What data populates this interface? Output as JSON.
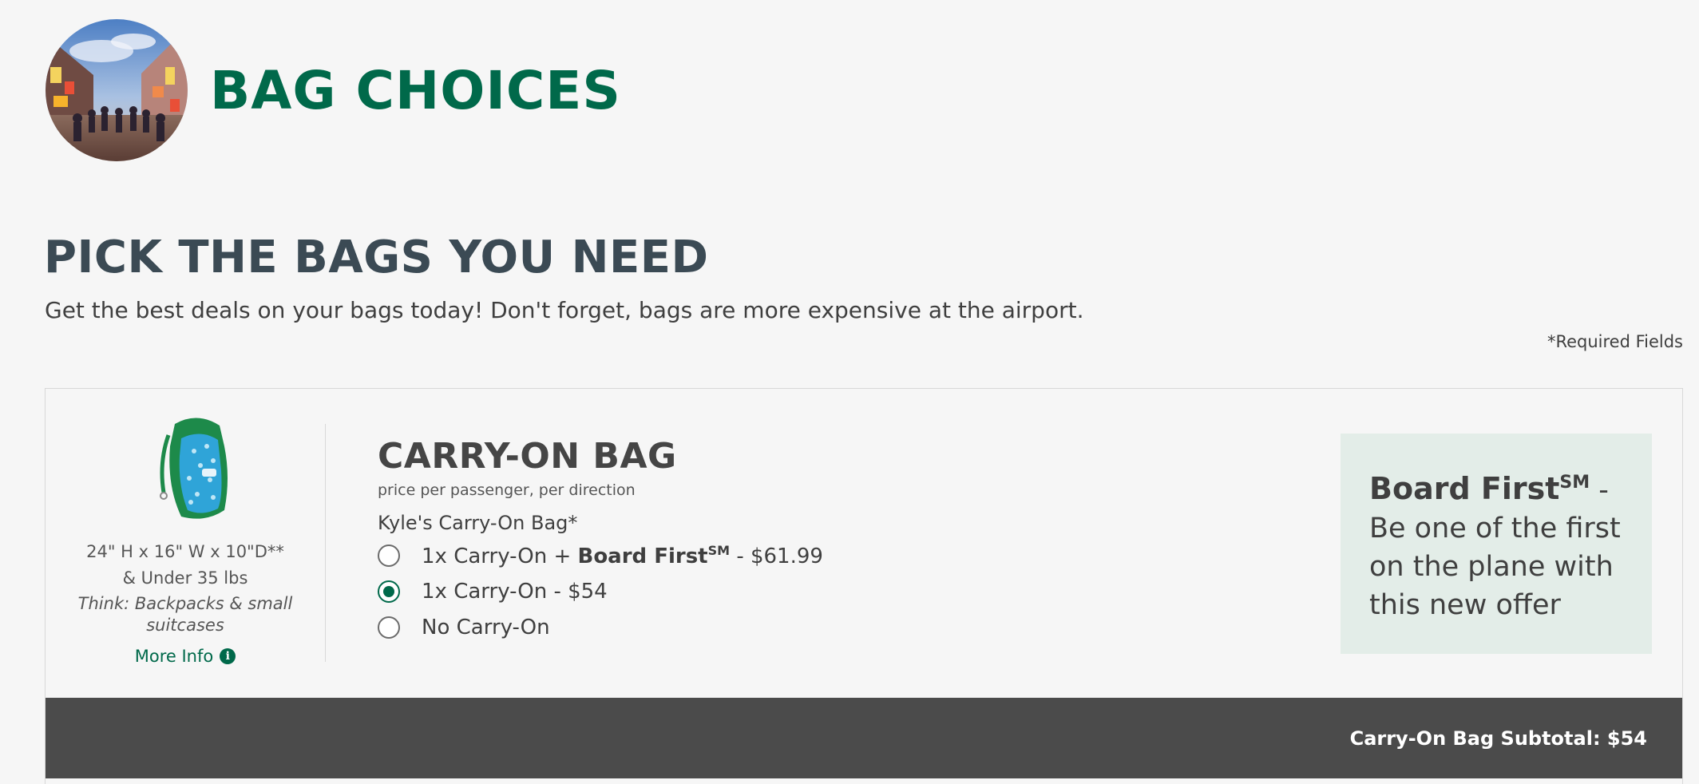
{
  "header": {
    "title": "BAG CHOICES"
  },
  "section": {
    "heading": "PICK THE BAGS YOU NEED",
    "subheading": "Get the best deals on your bags today! Don't forget, bags are more expensive at the airport.",
    "required_note": "*Required Fields"
  },
  "carry_on": {
    "dimensions": "24\" H x 16\" W x 10\"D** & Under 35 lbs",
    "think": "Think: Backpacks & small suitcases",
    "more_info": "More Info",
    "title": "CARRY-ON BAG",
    "price_note": "price per passenger, per direction",
    "passenger_label": "Kyle's Carry-On Bag*",
    "options": [
      {
        "prefix": "1x Carry-On + ",
        "bold": "Board First",
        "sup": "SM",
        "suffix": " - $61.99",
        "selected": false
      },
      {
        "prefix": "1x Carry-On - $54",
        "bold": "",
        "sup": "",
        "suffix": "",
        "selected": true
      },
      {
        "prefix": "No Carry-On",
        "bold": "",
        "sup": "",
        "suffix": "",
        "selected": false
      }
    ],
    "promo": {
      "bold": "Board First",
      "sup": "SM",
      "text": " - Be one of the first on the plane with this new offer"
    },
    "subtotal": "Carry-On Bag Subtotal: $54"
  },
  "colors": {
    "brand_green": "#00694a",
    "heading_slate": "#3b4a54",
    "promo_bg": "#e3ede8",
    "subtotal_bg": "#4b4b4b"
  }
}
